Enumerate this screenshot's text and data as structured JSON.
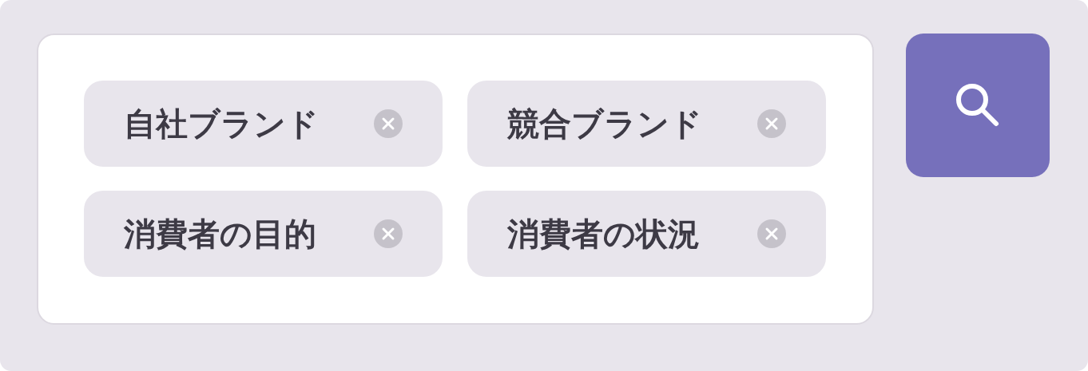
{
  "tags": [
    {
      "label": "自社ブランド"
    },
    {
      "label": "競合ブランド"
    },
    {
      "label": "消費者の目的"
    },
    {
      "label": "消費者の状況"
    }
  ]
}
